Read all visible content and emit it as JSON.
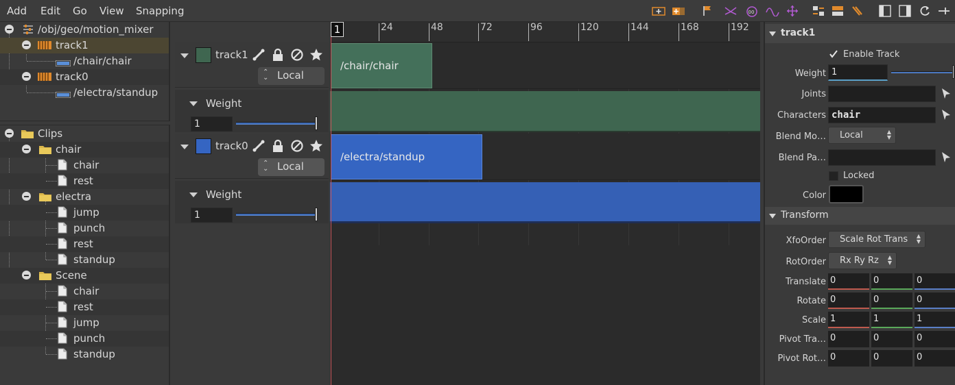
{
  "menubar": {
    "items": [
      "Add",
      "Edit",
      "Go",
      "View",
      "Snapping"
    ]
  },
  "node_tree": {
    "root": "/obj/geo/motion_mixer",
    "items": [
      {
        "label": "track1",
        "selected": true
      },
      {
        "label": "/chair/chair"
      },
      {
        "label": "track0"
      },
      {
        "label": "/electra/standup"
      }
    ]
  },
  "clips_tree": {
    "root": "Clips",
    "folders": [
      {
        "label": "chair",
        "files": [
          "chair",
          "rest"
        ]
      },
      {
        "label": "electra",
        "files": [
          "jump",
          "punch",
          "rest",
          "standup"
        ]
      },
      {
        "label": "Scene",
        "files": [
          "chair",
          "rest",
          "jump",
          "punch",
          "standup"
        ]
      }
    ]
  },
  "tracks": [
    {
      "name": "track1",
      "color": "#3f6650",
      "mode": "Local",
      "weight_label": "Weight",
      "weight": "1"
    },
    {
      "name": "track0",
      "color": "#3565c2",
      "mode": "Local",
      "weight_label": "Weight",
      "weight": "1"
    }
  ],
  "timeline": {
    "current_frame": "1",
    "ticks": [
      "24",
      "48",
      "72",
      "96",
      "120",
      "144",
      "168",
      "192"
    ],
    "clips": [
      {
        "label": "/chair/chair",
        "start": 1,
        "end": 48
      },
      {
        "label": "/electra/standup",
        "start": 1,
        "end": 72
      }
    ]
  },
  "params": {
    "section1_title": "track1",
    "enable_track_label": "Enable Track",
    "weight_label": "Weight",
    "weight": "1",
    "joints_label": "Joints",
    "joints": "",
    "characters_label": "Characters",
    "characters": "chair",
    "blend_mode_label": "Blend Mo…",
    "blend_mode": "Local",
    "blend_path_label": "Blend Pa…",
    "blend_path": "",
    "locked_label": "Locked",
    "color_label": "Color",
    "transform_title": "Transform",
    "xfo_order_label": "XfoOrder",
    "xfo_order": "Scale Rot Trans",
    "rot_order_label": "RotOrder",
    "rot_order": "Rx Ry Rz",
    "translate_label": "Translate",
    "translate": [
      "0",
      "0",
      "0"
    ],
    "rotate_label": "Rotate",
    "rotate": [
      "0",
      "0",
      "0"
    ],
    "scale_label": "Scale",
    "scale": [
      "1",
      "1",
      "1"
    ],
    "pivot_translate_label": "Pivot Tra…",
    "pivot_translate": [
      "0",
      "0",
      "0"
    ],
    "pivot_rotate_label": "Pivot Rot…",
    "pivot_rotate": [
      "0",
      "0",
      "0"
    ]
  }
}
